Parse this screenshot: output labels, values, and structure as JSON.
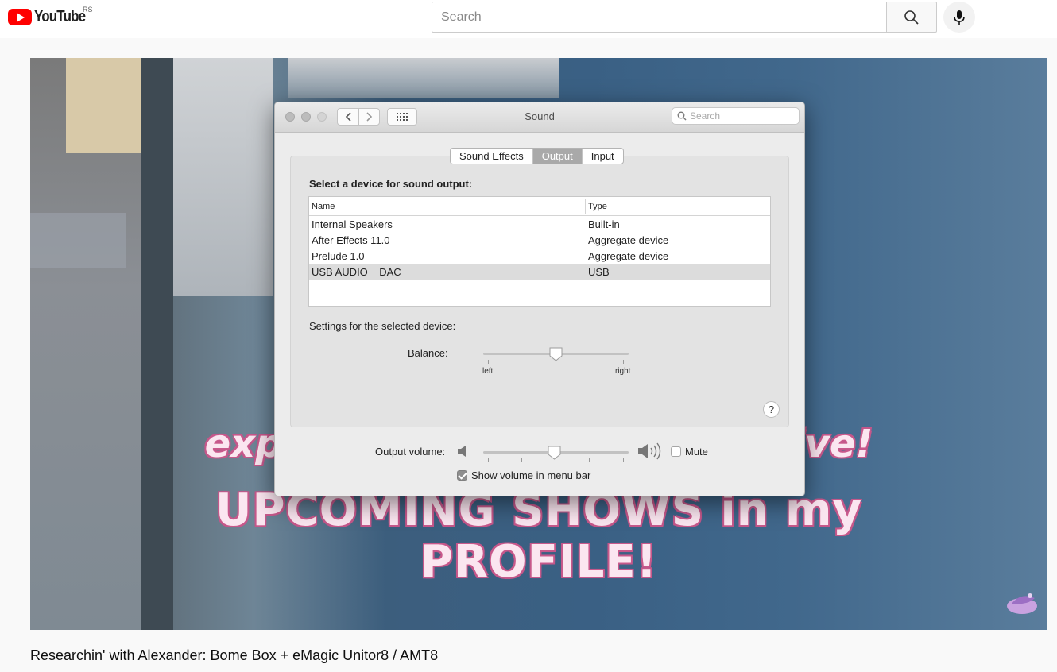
{
  "youtube": {
    "logo_text": "YouTube",
    "country_code": "RS",
    "search_placeholder": "Search"
  },
  "video": {
    "overlay_line1": "experi                                 live!",
    "overlay_line2": "UPCOMING SHOWS in my PROFILE!",
    "title": "Researchin' with Alexander: Bome Box + eMagic Unitor8 / AMT8"
  },
  "window": {
    "title": "Sound",
    "search_placeholder": "Search",
    "tabs": [
      {
        "label": "Sound Effects",
        "selected": false
      },
      {
        "label": "Output",
        "selected": true
      },
      {
        "label": "Input",
        "selected": false
      }
    ],
    "select_label": "Select a device for sound output:",
    "table": {
      "columns": [
        "Name",
        "Type"
      ],
      "rows": [
        {
          "name": "Internal Speakers",
          "type": "Built-in",
          "selected": false
        },
        {
          "name": "After Effects 11.0",
          "type": "Aggregate device",
          "selected": false
        },
        {
          "name": "Prelude 1.0",
          "type": "Aggregate device",
          "selected": false
        },
        {
          "name": "USB AUDIO    DAC",
          "type": "USB",
          "selected": true
        }
      ]
    },
    "settings_label": "Settings for the selected device:",
    "balance_label": "Balance:",
    "balance_left": "left",
    "balance_right": "right",
    "balance_value": 0.5,
    "help_label": "?",
    "output_volume_label": "Output volume:",
    "output_volume_value": 0.49,
    "mute_label": "Mute",
    "mute_checked": false,
    "show_volume_label": "Show volume in menu bar",
    "show_volume_checked": true
  },
  "colors": {
    "youtube_red": "#ff0000",
    "selected_tab": "#a9a9a9",
    "selected_row": "#dcdcdc"
  }
}
